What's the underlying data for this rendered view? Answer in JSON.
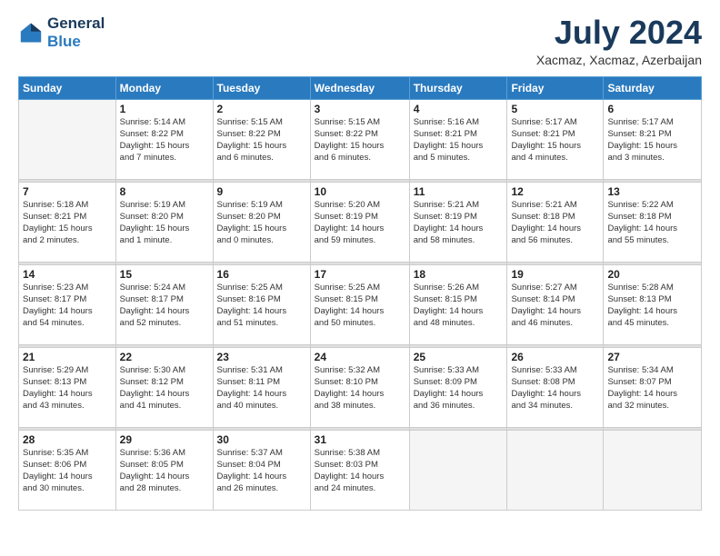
{
  "logo": {
    "line1": "General",
    "line2": "Blue"
  },
  "title": "July 2024",
  "subtitle": "Xacmaz, Xacmaz, Azerbaijan",
  "headers": [
    "Sunday",
    "Monday",
    "Tuesday",
    "Wednesday",
    "Thursday",
    "Friday",
    "Saturday"
  ],
  "weeks": [
    [
      {
        "day": "",
        "info": ""
      },
      {
        "day": "1",
        "info": "Sunrise: 5:14 AM\nSunset: 8:22 PM\nDaylight: 15 hours\nand 7 minutes."
      },
      {
        "day": "2",
        "info": "Sunrise: 5:15 AM\nSunset: 8:22 PM\nDaylight: 15 hours\nand 6 minutes."
      },
      {
        "day": "3",
        "info": "Sunrise: 5:15 AM\nSunset: 8:22 PM\nDaylight: 15 hours\nand 6 minutes."
      },
      {
        "day": "4",
        "info": "Sunrise: 5:16 AM\nSunset: 8:21 PM\nDaylight: 15 hours\nand 5 minutes."
      },
      {
        "day": "5",
        "info": "Sunrise: 5:17 AM\nSunset: 8:21 PM\nDaylight: 15 hours\nand 4 minutes."
      },
      {
        "day": "6",
        "info": "Sunrise: 5:17 AM\nSunset: 8:21 PM\nDaylight: 15 hours\nand 3 minutes."
      }
    ],
    [
      {
        "day": "7",
        "info": "Sunrise: 5:18 AM\nSunset: 8:21 PM\nDaylight: 15 hours\nand 2 minutes."
      },
      {
        "day": "8",
        "info": "Sunrise: 5:19 AM\nSunset: 8:20 PM\nDaylight: 15 hours\nand 1 minute."
      },
      {
        "day": "9",
        "info": "Sunrise: 5:19 AM\nSunset: 8:20 PM\nDaylight: 15 hours\nand 0 minutes."
      },
      {
        "day": "10",
        "info": "Sunrise: 5:20 AM\nSunset: 8:19 PM\nDaylight: 14 hours\nand 59 minutes."
      },
      {
        "day": "11",
        "info": "Sunrise: 5:21 AM\nSunset: 8:19 PM\nDaylight: 14 hours\nand 58 minutes."
      },
      {
        "day": "12",
        "info": "Sunrise: 5:21 AM\nSunset: 8:18 PM\nDaylight: 14 hours\nand 56 minutes."
      },
      {
        "day": "13",
        "info": "Sunrise: 5:22 AM\nSunset: 8:18 PM\nDaylight: 14 hours\nand 55 minutes."
      }
    ],
    [
      {
        "day": "14",
        "info": "Sunrise: 5:23 AM\nSunset: 8:17 PM\nDaylight: 14 hours\nand 54 minutes."
      },
      {
        "day": "15",
        "info": "Sunrise: 5:24 AM\nSunset: 8:17 PM\nDaylight: 14 hours\nand 52 minutes."
      },
      {
        "day": "16",
        "info": "Sunrise: 5:25 AM\nSunset: 8:16 PM\nDaylight: 14 hours\nand 51 minutes."
      },
      {
        "day": "17",
        "info": "Sunrise: 5:25 AM\nSunset: 8:15 PM\nDaylight: 14 hours\nand 50 minutes."
      },
      {
        "day": "18",
        "info": "Sunrise: 5:26 AM\nSunset: 8:15 PM\nDaylight: 14 hours\nand 48 minutes."
      },
      {
        "day": "19",
        "info": "Sunrise: 5:27 AM\nSunset: 8:14 PM\nDaylight: 14 hours\nand 46 minutes."
      },
      {
        "day": "20",
        "info": "Sunrise: 5:28 AM\nSunset: 8:13 PM\nDaylight: 14 hours\nand 45 minutes."
      }
    ],
    [
      {
        "day": "21",
        "info": "Sunrise: 5:29 AM\nSunset: 8:13 PM\nDaylight: 14 hours\nand 43 minutes."
      },
      {
        "day": "22",
        "info": "Sunrise: 5:30 AM\nSunset: 8:12 PM\nDaylight: 14 hours\nand 41 minutes."
      },
      {
        "day": "23",
        "info": "Sunrise: 5:31 AM\nSunset: 8:11 PM\nDaylight: 14 hours\nand 40 minutes."
      },
      {
        "day": "24",
        "info": "Sunrise: 5:32 AM\nSunset: 8:10 PM\nDaylight: 14 hours\nand 38 minutes."
      },
      {
        "day": "25",
        "info": "Sunrise: 5:33 AM\nSunset: 8:09 PM\nDaylight: 14 hours\nand 36 minutes."
      },
      {
        "day": "26",
        "info": "Sunrise: 5:33 AM\nSunset: 8:08 PM\nDaylight: 14 hours\nand 34 minutes."
      },
      {
        "day": "27",
        "info": "Sunrise: 5:34 AM\nSunset: 8:07 PM\nDaylight: 14 hours\nand 32 minutes."
      }
    ],
    [
      {
        "day": "28",
        "info": "Sunrise: 5:35 AM\nSunset: 8:06 PM\nDaylight: 14 hours\nand 30 minutes."
      },
      {
        "day": "29",
        "info": "Sunrise: 5:36 AM\nSunset: 8:05 PM\nDaylight: 14 hours\nand 28 minutes."
      },
      {
        "day": "30",
        "info": "Sunrise: 5:37 AM\nSunset: 8:04 PM\nDaylight: 14 hours\nand 26 minutes."
      },
      {
        "day": "31",
        "info": "Sunrise: 5:38 AM\nSunset: 8:03 PM\nDaylight: 14 hours\nand 24 minutes."
      },
      {
        "day": "",
        "info": ""
      },
      {
        "day": "",
        "info": ""
      },
      {
        "day": "",
        "info": ""
      }
    ]
  ]
}
